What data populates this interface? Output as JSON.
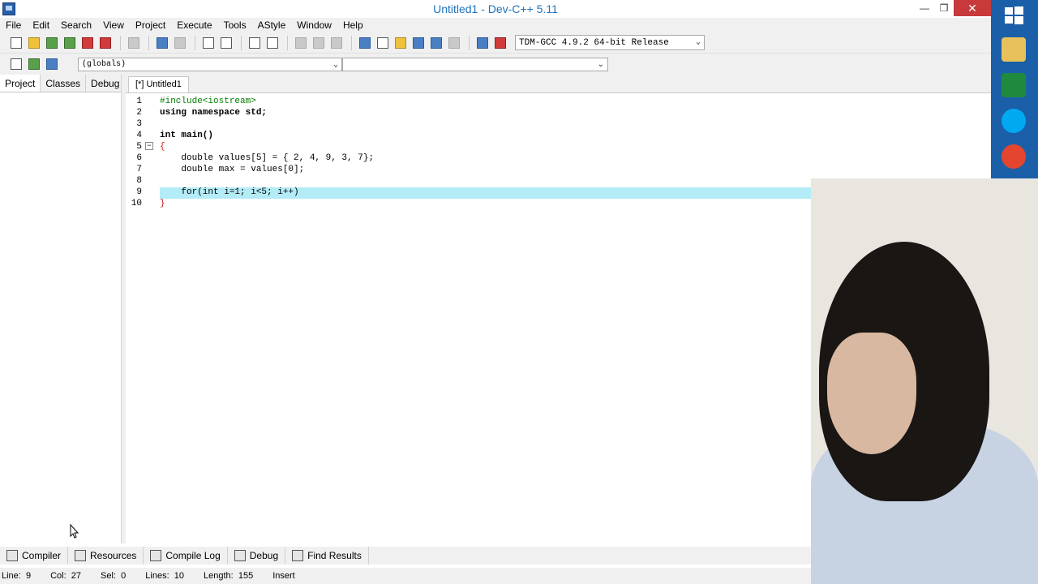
{
  "window": {
    "title": "Untitled1 - Dev-C++ 5.11",
    "minimize": "—",
    "restore": "❐",
    "close": "✕"
  },
  "menu": [
    "File",
    "Edit",
    "Search",
    "View",
    "Project",
    "Execute",
    "Tools",
    "AStyle",
    "Window",
    "Help"
  ],
  "toolbar": {
    "compiler": "TDM-GCC 4.9.2 64-bit Release"
  },
  "toolbar2": {
    "globals": "(globals)"
  },
  "left_panel": {
    "tabs": [
      "Project",
      "Classes",
      "Debug"
    ]
  },
  "editor": {
    "tab": "[*] Untitled1",
    "lines": [
      {
        "n": "1",
        "text": "#include<iostream>"
      },
      {
        "n": "2",
        "text": "using namespace std;"
      },
      {
        "n": "3",
        "text": ""
      },
      {
        "n": "4",
        "text": "int main()"
      },
      {
        "n": "5",
        "text": "{"
      },
      {
        "n": "6",
        "text": "    double values[5] = { 2, 4, 9, 3, 7};"
      },
      {
        "n": "7",
        "text": "    double max = values[0];"
      },
      {
        "n": "8",
        "text": ""
      },
      {
        "n": "9",
        "text": "    for(int i=1; i<5; i++)"
      },
      {
        "n": "10",
        "text": "}"
      }
    ]
  },
  "bottom_tabs": [
    "Compiler",
    "Resources",
    "Compile Log",
    "Debug",
    "Find Results"
  ],
  "status": {
    "line_label": "Line:",
    "line": "9",
    "col_label": "Col:",
    "col": "27",
    "sel_label": "Sel:",
    "sel": "0",
    "lines_label": "Lines:",
    "lines": "10",
    "length_label": "Length:",
    "length": "155",
    "mode": "Insert"
  },
  "colors": {
    "accent": "#1e73be",
    "highlight": "#b3ecf7",
    "close": "#c7393a",
    "taskbar": "#1b5fa8"
  }
}
